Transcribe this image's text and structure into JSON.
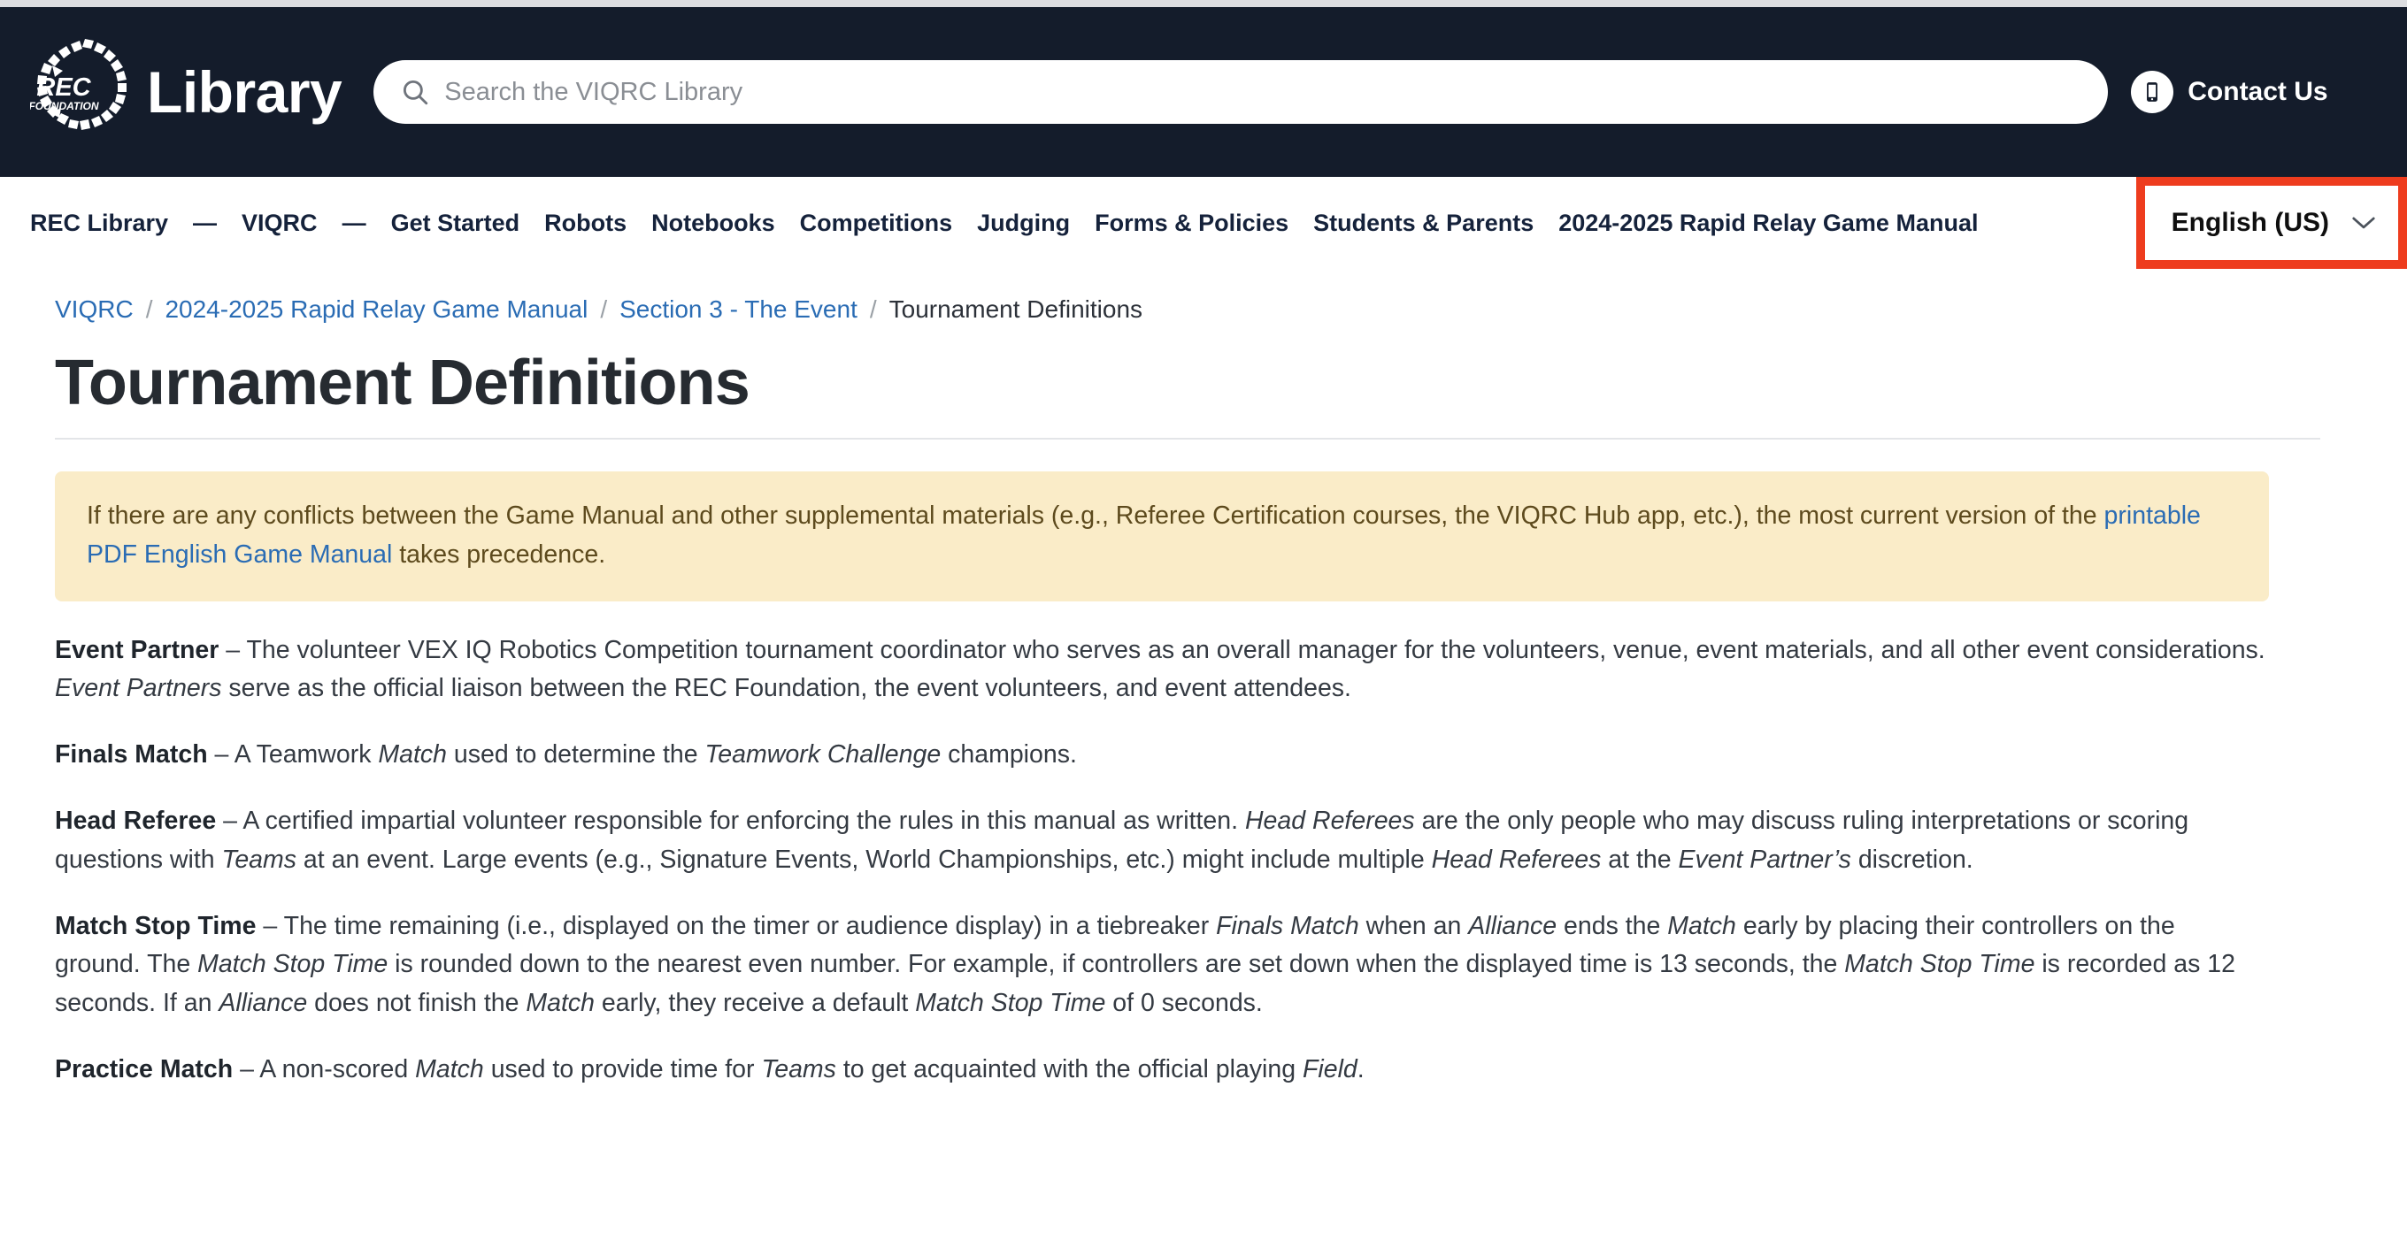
{
  "colors": {
    "header_bg": "#141c2b",
    "accent_red": "#ee3c1e",
    "link_blue": "#2a6cb4",
    "callout_bg": "#faecc8",
    "callout_text": "#5d4a1d"
  },
  "header": {
    "logo_text_top": "REC",
    "logo_text_bottom": "FOUNDATION",
    "brand_title": "Library",
    "search": {
      "placeholder": "Search the VIQRC Library",
      "value": "",
      "icon": "search-icon"
    },
    "contact": {
      "label": "Contact Us",
      "icon": "mobile-phone-icon"
    }
  },
  "nav": {
    "items": [
      {
        "label": "REC Library",
        "type": "link"
      },
      {
        "label": "—",
        "type": "separator"
      },
      {
        "label": "VIQRC",
        "type": "link"
      },
      {
        "label": "—",
        "type": "separator"
      },
      {
        "label": "Get Started",
        "type": "link"
      },
      {
        "label": "Robots",
        "type": "link"
      },
      {
        "label": "Notebooks",
        "type": "link"
      },
      {
        "label": "Competitions",
        "type": "link"
      },
      {
        "label": "Judging",
        "type": "link"
      },
      {
        "label": "Forms & Policies",
        "type": "link"
      },
      {
        "label": "Students & Parents",
        "type": "link"
      },
      {
        "label": "2024-2025 Rapid Relay Game Manual",
        "type": "link"
      }
    ],
    "language_selector": {
      "label": "English (US)",
      "icon": "chevron-down-icon",
      "highlighted": true
    }
  },
  "breadcrumb": {
    "separator": "/",
    "items": [
      {
        "label": "VIQRC",
        "current": false
      },
      {
        "label": "2024-2025 Rapid Relay Game Manual",
        "current": false
      },
      {
        "label": "Section 3 - The Event",
        "current": false
      },
      {
        "label": "Tournament Definitions",
        "current": true
      }
    ]
  },
  "main": {
    "page_title": "Tournament Definitions",
    "callout": {
      "text_before": "If there are any conflicts between the Game Manual and other supplemental materials (e.g., Referee Certification courses, the VIQRC Hub app, etc.), the most current version of the ",
      "link_text": "printable PDF English Game Manual",
      "text_after": " takes precedence."
    },
    "definitions": [
      {
        "term": "Event Partner",
        "dash": " – ",
        "body_html": "The volunteer VEX IQ Robotics Competition tournament coordinator who serves as an overall manager for the volunteers, venue, event materials, and all other event considerations. <i>Event Partners</i> serve as the official liaison between the REC Foundation, the event volunteers, and event attendees."
      },
      {
        "term": "Finals Match",
        "dash": " – ",
        "body_html": "A Teamwork <i>Match</i> used to determine the <i>Teamwork Challenge</i> champions."
      },
      {
        "term": "Head Referee",
        "dash": " – ",
        "body_html": "A certified impartial volunteer responsible for enforcing the rules in this manual as written. <i>Head Referees</i> are the only people who may discuss ruling interpretations or scoring questions with <i>Teams</i> at an event. Large events (e.g., Signature Events, World Championships, etc.) might include multiple <i>Head Referees</i> at the <i>Event Partner’s</i> discretion."
      },
      {
        "term": "Match Stop Time",
        "dash": " – ",
        "body_html": "The time remaining (i.e., displayed on the timer or audience display) in a tiebreaker <i>Finals Match</i> when an <i>Alliance</i> ends the <i>Match</i> early by placing their controllers on the ground. The <i>Match Stop Time</i> is rounded down to the nearest even number. For example, if controllers are set down when the displayed time is 13 seconds, the <i>Match Stop Time</i> is recorded as 12 seconds. If an <i>Alliance</i> does not finish the <i>Match</i> early, they receive a default <i>Match Stop Time</i> of 0 seconds."
      },
      {
        "term": "Practice Match",
        "dash": " – ",
        "body_html": "A non-scored <i>Match</i> used to provide time for <i>Teams</i> to get acquainted with the official playing <i>Field</i>."
      }
    ]
  }
}
